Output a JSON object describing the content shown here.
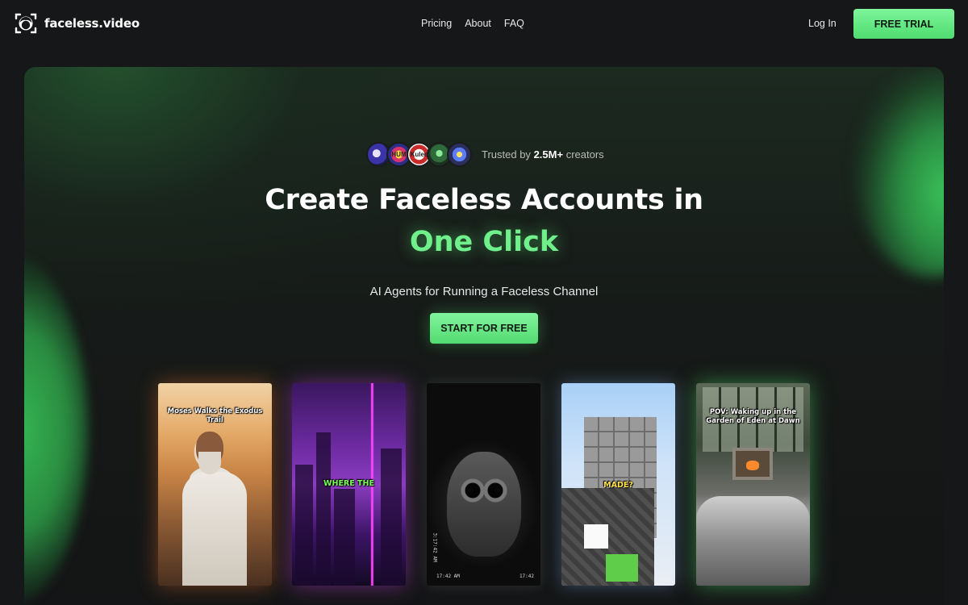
{
  "nav": {
    "brand": "faceless.video",
    "links": [
      "Pricing",
      "About",
      "FAQ"
    ],
    "login": "Log In",
    "cta": "FREE TRIAL"
  },
  "hero": {
    "trusted_prefix": "Trusted by",
    "trusted_count": "2.5M+",
    "trusted_suffix": "creators",
    "avatar_labels": [
      "",
      "HUM",
      "Kulee",
      "",
      ""
    ],
    "headline_line1": "Create Faceless Accounts in",
    "headline_line2": "One Click",
    "subheadline": "AI Agents for Running a Faceless Channel",
    "cta": "START FOR FREE",
    "accent_color": "#6ff08a"
  },
  "videos": [
    {
      "caption": "Moses Walks the Exodus Trail"
    },
    {
      "caption": "WHERE THE"
    },
    {
      "caption": "",
      "timestamp_bottom_left": "17:42 AM",
      "timestamp_bottom_right": "17:42",
      "timestamp_side": "3:17:42 AM"
    },
    {
      "caption": "MADE?"
    },
    {
      "caption": "POV: Waking up in the Garden of Eden at Dawn"
    }
  ]
}
